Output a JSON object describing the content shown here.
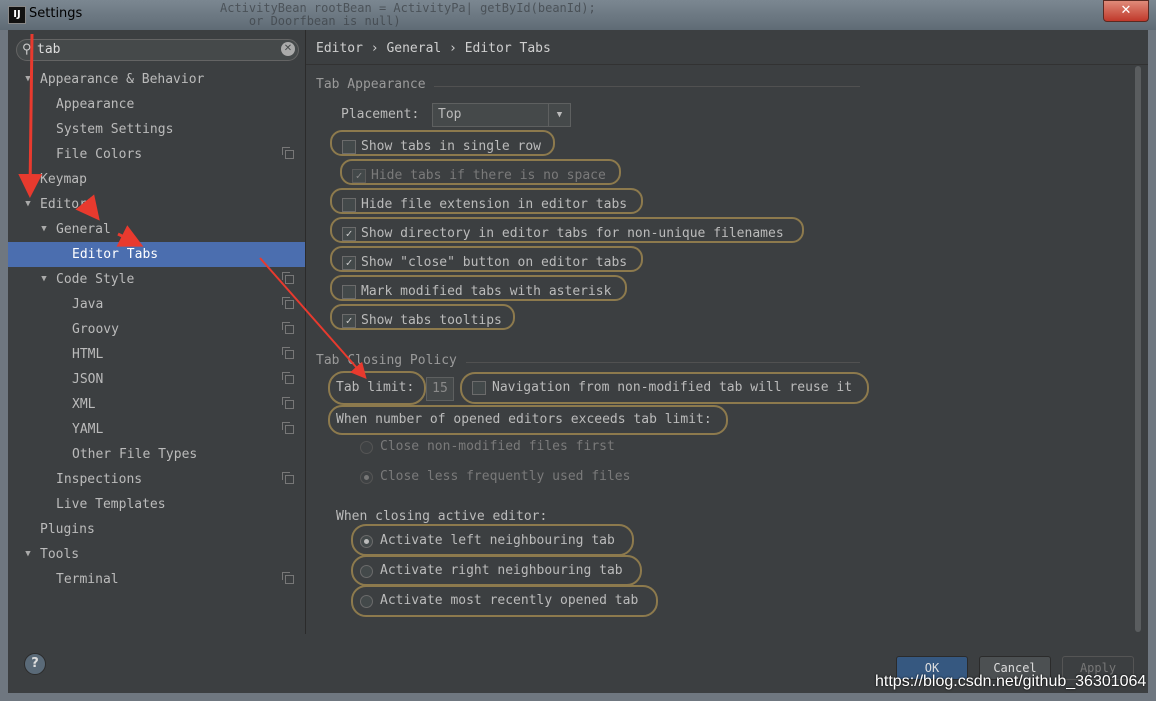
{
  "window": {
    "title": "Settings",
    "app_icon_text": "IJ",
    "close_glyph": "✕",
    "background_code": "ActivityBean rootBean = ActivityPa| getById(beanId);\n    or Doorfbean is null)"
  },
  "search": {
    "value": "tab",
    "placeholder": ""
  },
  "tree": [
    {
      "label": "Appearance & Behavior",
      "level": 0,
      "arrow": "▼",
      "bold": false,
      "copy": false
    },
    {
      "label": "Appearance",
      "level": 1,
      "arrow": "",
      "copy": false
    },
    {
      "label": "System Settings",
      "level": 1,
      "arrow": "",
      "copy": false
    },
    {
      "label": "File Colors",
      "level": 1,
      "arrow": "",
      "copy": true
    },
    {
      "label": "Keymap",
      "level": 0,
      "arrow": "",
      "copy": false
    },
    {
      "label": "Editor",
      "level": 0,
      "arrow": "▼",
      "copy": false
    },
    {
      "label": "General",
      "level": 1,
      "arrow": "▼",
      "copy": false
    },
    {
      "label": "Editor Tabs",
      "level": 2,
      "arrow": "",
      "copy": false,
      "selected": true
    },
    {
      "label": "Code Style",
      "level": 1,
      "arrow": "▼",
      "copy": true
    },
    {
      "label": "Java",
      "level": 2,
      "arrow": "",
      "copy": true
    },
    {
      "label": "Groovy",
      "level": 2,
      "arrow": "",
      "copy": true
    },
    {
      "label": "HTML",
      "level": 2,
      "arrow": "",
      "copy": true
    },
    {
      "label": "JSON",
      "level": 2,
      "arrow": "",
      "copy": true
    },
    {
      "label": "XML",
      "level": 2,
      "arrow": "",
      "copy": true
    },
    {
      "label": "YAML",
      "level": 2,
      "arrow": "",
      "copy": true
    },
    {
      "label": "Other File Types",
      "level": 2,
      "arrow": "",
      "copy": false
    },
    {
      "label": "Inspections",
      "level": 1,
      "arrow": "",
      "copy": true
    },
    {
      "label": "Live Templates",
      "level": 1,
      "arrow": "",
      "copy": false
    },
    {
      "label": "Plugins",
      "level": 0,
      "arrow": "",
      "copy": false
    },
    {
      "label": "Tools",
      "level": 0,
      "arrow": "▼",
      "copy": false
    },
    {
      "label": "Terminal",
      "level": 1,
      "arrow": "",
      "copy": true
    }
  ],
  "breadcrumb": {
    "text": "Editor › General › Editor Tabs"
  },
  "tab_appearance": {
    "title": "Tab Appearance",
    "placement_label": "Placement:",
    "placement_value": "Top",
    "options": [
      {
        "label": "Show tabs in single row",
        "checked": false,
        "disabled": false
      },
      {
        "label": "Hide tabs if there is no space",
        "checked": true,
        "disabled": true
      },
      {
        "label": "Hide file extension in editor tabs",
        "checked": false,
        "disabled": false
      },
      {
        "label": "Show directory in editor tabs for non-unique filenames",
        "checked": true,
        "disabled": false
      },
      {
        "label": "Show \"close\" button on editor tabs",
        "checked": true,
        "disabled": false
      },
      {
        "label": "Mark modified tabs with asterisk",
        "checked": false,
        "disabled": false
      },
      {
        "label": "Show tabs tooltips",
        "checked": true,
        "disabled": false
      }
    ]
  },
  "tab_closing": {
    "title": "Tab Closing Policy",
    "tab_limit_label": "Tab limit:",
    "tab_limit_value": "15",
    "nav_reuse_label": "Navigation from non-modified tab will reuse it",
    "nav_reuse_checked": false,
    "exceeds_label": "When number of opened editors exceeds tab limit:",
    "exceeds_options": [
      {
        "label": "Close non-modified files first",
        "selected": false
      },
      {
        "label": "Close less frequently used files",
        "selected": true
      }
    ],
    "closing_active_label": "When closing active editor:",
    "closing_active_options": [
      {
        "label": "Activate left neighbouring tab",
        "selected": true
      },
      {
        "label": "Activate right neighbouring tab",
        "selected": false
      },
      {
        "label": "Activate most recently opened tab",
        "selected": false
      }
    ]
  },
  "buttons": {
    "help": "?",
    "ok": "OK",
    "cancel": "Cancel",
    "apply": "Apply"
  },
  "watermark": "https://blog.csdn.net/github_36301064",
  "colors": {
    "selection": "#4b6eaf",
    "highlight_pill": "#8d7a4d",
    "annotation": "#e83a2e"
  }
}
